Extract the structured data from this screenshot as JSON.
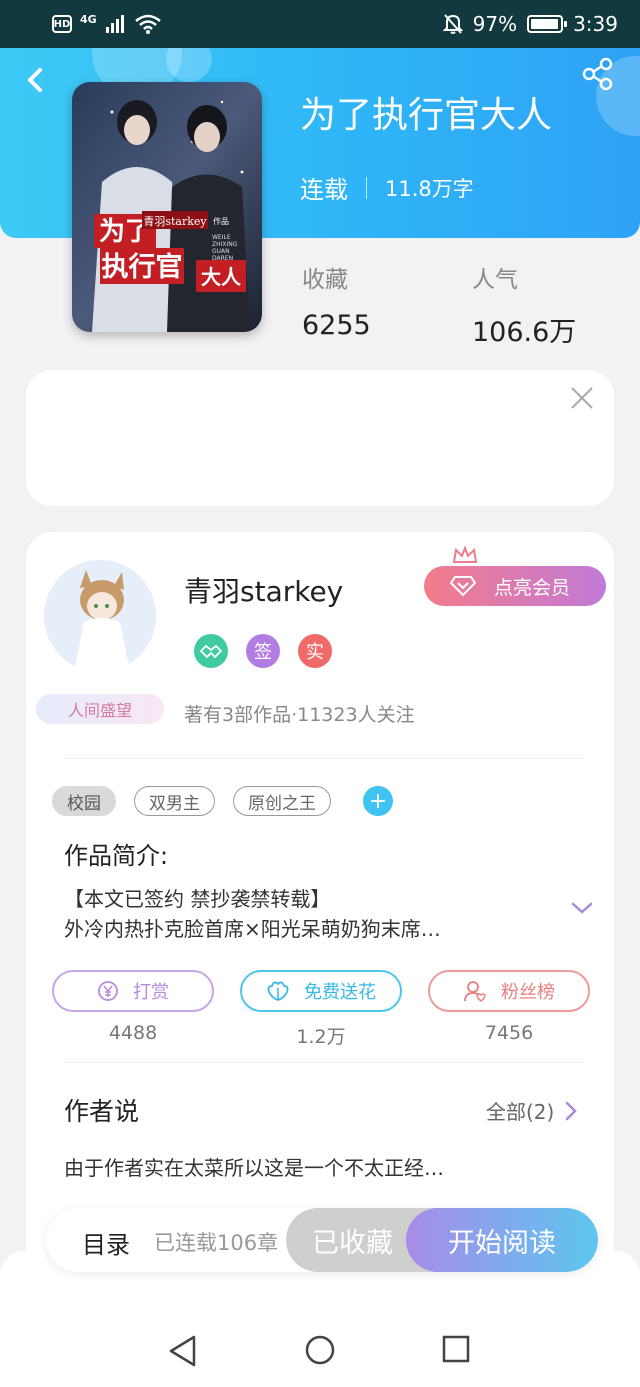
{
  "status_bar": {
    "hd": "HD",
    "signal": "4G",
    "battery": "97%",
    "battery_level": 0.97,
    "time": "3:39"
  },
  "icons": {
    "back": "chevron-left-icon",
    "share": "share-icon",
    "close": "close-icon",
    "crown": "crown-icon",
    "diamond": "diamond-icon",
    "expand": "chevron-down-icon",
    "more": "chevron-right-icon"
  },
  "book": {
    "title": "为了执行官大人",
    "status": "连载",
    "word_count": "11.8万字",
    "cover": {
      "title_line1": "为了",
      "title_line2": "执行官",
      "title_line3": "大人",
      "author_stamp": "青羽starkey",
      "stamp_suffix": "作品",
      "pinyin_line1": "WEILE",
      "pinyin_line2": "ZHIXING",
      "pinyin_line3": "GUAN",
      "pinyin_line4": "DAREN"
    }
  },
  "stats": {
    "favorites_label": "收藏",
    "favorites_value": "6255",
    "popularity_label": "人气",
    "popularity_value": "106.6万"
  },
  "author": {
    "name": "青羽starkey",
    "vip_button": "点亮会员",
    "badges": [
      "",
      "签",
      "实"
    ],
    "rank_title": "人间盛望",
    "summary": "著有3部作品·11323人关注"
  },
  "tags": [
    "校园",
    "双男主",
    "原创之王"
  ],
  "tag_add": "+",
  "intro": {
    "title": "作品简介:",
    "line1": "【本文已签约 禁抄袭禁转载】",
    "line2": "外冷内热扑克脸首席×阳光呆萌奶狗末席…"
  },
  "actions": [
    {
      "label": "打赏",
      "count": "4488",
      "icon": "yen-coin-icon",
      "color": "#b98be0"
    },
    {
      "label": "免费送花",
      "count": "1.2万",
      "icon": "flower-icon",
      "color": "#4cc6ee"
    },
    {
      "label": "粉丝榜",
      "count": "7456",
      "icon": "fan-user-icon",
      "color": "#ec7d7d"
    }
  ],
  "author_says": {
    "title": "作者说",
    "view_all": "全部(2)",
    "preview": "由于作者实在太菜所以这是一个不太正经…"
  },
  "bottom_bar": {
    "toc": "目录",
    "toc_count": "已连载106章",
    "collected": "已收藏",
    "read": "开始阅读"
  }
}
